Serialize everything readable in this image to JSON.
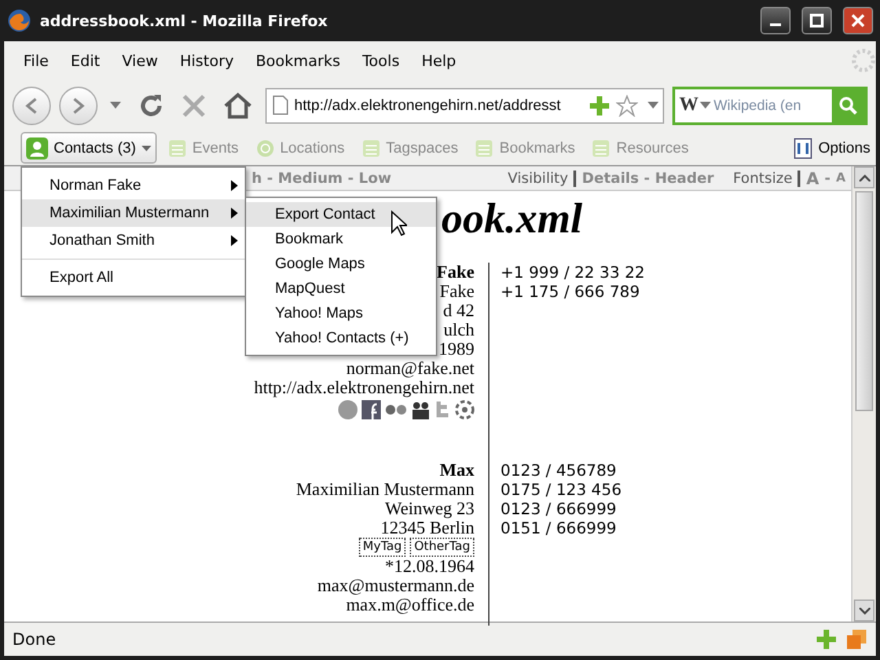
{
  "window": {
    "title": "addressbook.xml - Mozilla Firefox"
  },
  "menu": [
    "File",
    "Edit",
    "View",
    "History",
    "Bookmarks",
    "Tools",
    "Help"
  ],
  "navigation": {
    "url": "http://adx.elektronengehirn.net/addresst",
    "search_engine_logo": "W",
    "search_placeholder": "Wikipedia (en"
  },
  "sidebar_tabs": [
    {
      "label": "Contacts (3)",
      "selected": true
    },
    {
      "label": "Events",
      "selected": false
    },
    {
      "label": "Locations",
      "selected": false
    },
    {
      "label": "Tagspaces",
      "selected": false
    },
    {
      "label": "Bookmarks",
      "selected": false
    },
    {
      "label": "Resources",
      "selected": false
    }
  ],
  "options_label": "Options",
  "header": {
    "priority": "h - Medium - Low",
    "visibility_label": "Visibility",
    "visibility_options": "Details - Header",
    "fontsize_label": "Fontsize",
    "fontsize_large": "A",
    "fontsize_separator": "-",
    "fontsize_small": "A"
  },
  "page_title": "ook.xml",
  "contacts": [
    {
      "lines": [
        {
          "kind": "name",
          "text": "Fake"
        },
        {
          "kind": "text",
          "text": "Fake"
        },
        {
          "kind": "text",
          "text": "d 42"
        },
        {
          "kind": "text",
          "text": "ulch"
        },
        {
          "kind": "text",
          "text": "1989"
        },
        {
          "kind": "text",
          "text": "norman@fake.net"
        },
        {
          "kind": "text",
          "text": "http://adx.elektronengehirn.net"
        },
        {
          "kind": "social"
        }
      ],
      "phones": [
        "+1 999 / 22 33 22",
        "+1 175 / 666 789"
      ]
    },
    {
      "lines": [
        {
          "kind": "name",
          "text": "Max"
        },
        {
          "kind": "text",
          "text": "Maximilian Mustermann"
        },
        {
          "kind": "text",
          "text": "Weinweg 23"
        },
        {
          "kind": "text",
          "text": "12345 Berlin"
        },
        {
          "kind": "tags",
          "tags": [
            "MyTag",
            "OtherTag"
          ]
        },
        {
          "kind": "text",
          "text": "*12.08.1964"
        },
        {
          "kind": "text",
          "text": "max@mustermann.de"
        },
        {
          "kind": "text",
          "text": "max.m@office.de"
        }
      ],
      "phones": [
        "0123 / 456789",
        "0175 / 123 456",
        "0123 / 666999",
        "0151 / 666999"
      ]
    }
  ],
  "contacts_menu": [
    {
      "label": "Norman Fake",
      "submenu": true,
      "selected": false
    },
    {
      "label": "Maximilian Mustermann",
      "submenu": true,
      "selected": true
    },
    {
      "label": "Jonathan Smith",
      "submenu": true,
      "selected": false
    },
    {
      "label": "Export All",
      "submenu": false,
      "selected": false
    }
  ],
  "contact_submenu": [
    {
      "label": "Export Contact",
      "selected": true
    },
    {
      "label": "Bookmark",
      "selected": false
    },
    {
      "label": "Google Maps",
      "selected": false
    },
    {
      "label": "MapQuest",
      "selected": false
    },
    {
      "label": "Yahoo! Maps",
      "selected": false
    },
    {
      "label": "Yahoo! Contacts (+)",
      "selected": false
    }
  ],
  "status": "Done"
}
